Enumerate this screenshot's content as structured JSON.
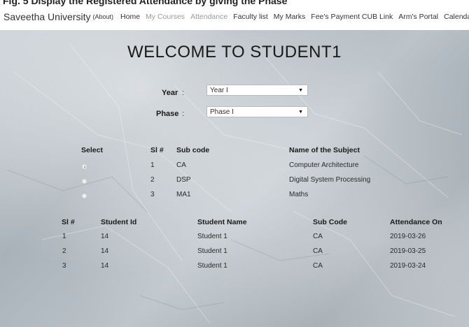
{
  "caption": "Fig. 5 Display the Registered Attendance by giving the Phase",
  "nav": {
    "brand": "Saveetha University",
    "brand_about": "(About)",
    "links": [
      {
        "label": "Home",
        "muted": false
      },
      {
        "label": "My Courses",
        "muted": true
      },
      {
        "label": "Attendance",
        "muted": true
      },
      {
        "label": "Faculty list",
        "muted": false
      },
      {
        "label": "My Marks",
        "muted": false
      },
      {
        "label": "Fee's Payment CUB Link",
        "muted": false
      },
      {
        "label": "Arm's Portal",
        "muted": false
      },
      {
        "label": "Calendar",
        "muted": false
      }
    ]
  },
  "welcome": "WELCOME TO STUDENT1",
  "form": {
    "year_label": "Year",
    "phase_label": "Phase",
    "colon": ":",
    "year_value": "Year I",
    "phase_value": "Phase I"
  },
  "subjects": {
    "headers": {
      "select": "Select",
      "sl": "Sl #",
      "sub_code": "Sub code",
      "name": "Name of the Subject"
    },
    "rows": [
      {
        "sl": "1",
        "code": "CA",
        "name": "Computer Architecture",
        "checked": true
      },
      {
        "sl": "2",
        "code": "DSP",
        "name": "Digital System Processing",
        "checked": false
      },
      {
        "sl": "3",
        "code": "MA1",
        "name": "Maths",
        "checked": false
      }
    ]
  },
  "attendance": {
    "headers": {
      "sl": "Sl #",
      "student_id": "Student Id",
      "student_name": "Student Name",
      "sub_code": "Sub Code",
      "attendance_on": "Attendance On"
    },
    "rows": [
      {
        "sl": "1",
        "student_id": "14",
        "student_name": "Student 1",
        "sub_code": "CA",
        "attendance_on": "2019-03-26"
      },
      {
        "sl": "2",
        "student_id": "14",
        "student_name": "Student 1",
        "sub_code": "CA",
        "attendance_on": "2019-03-25"
      },
      {
        "sl": "3",
        "student_id": "14",
        "student_name": "Student 1",
        "sub_code": "CA",
        "attendance_on": "2019-03-24"
      }
    ]
  }
}
